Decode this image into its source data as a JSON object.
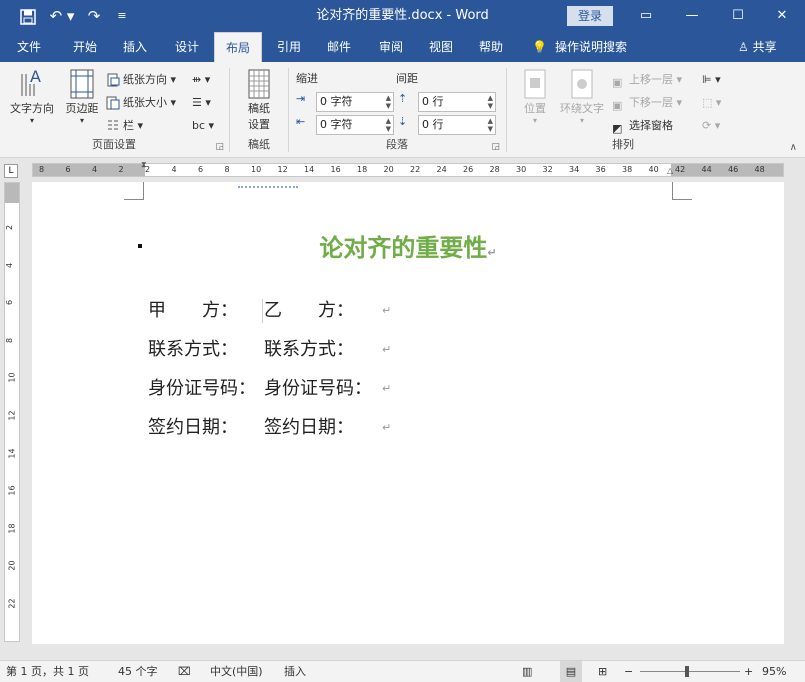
{
  "window": {
    "title": "论对齐的重要性.docx - Word",
    "login_label": "登录",
    "quick_access": [
      "save-icon",
      "undo-icon",
      "redo-icon",
      "customize-icon"
    ]
  },
  "tabs": [
    {
      "label": "文件",
      "active": false
    },
    {
      "label": "开始",
      "active": false
    },
    {
      "label": "插入",
      "active": false
    },
    {
      "label": "设计",
      "active": false
    },
    {
      "label": "布局",
      "active": true
    },
    {
      "label": "引用",
      "active": false
    },
    {
      "label": "邮件",
      "active": false
    },
    {
      "label": "审阅",
      "active": false
    },
    {
      "label": "视图",
      "active": false
    },
    {
      "label": "帮助",
      "active": false
    }
  ],
  "tell_me": "操作说明搜索",
  "share": "共享",
  "ribbon": {
    "page_setup": {
      "label": "页面设置",
      "text_direction": "文字方向",
      "margins": "页边距",
      "orientation": "纸张方向",
      "size": "纸张大小",
      "columns": "栏"
    },
    "manuscript": {
      "label": "稿纸",
      "button_line1": "稿纸",
      "button_line2": "设置"
    },
    "paragraph": {
      "label": "段落",
      "indent_label": "缩进",
      "spacing_label": "间距",
      "indent_left": "0 字符",
      "indent_right": "0 字符",
      "spacing_before": "0 行",
      "spacing_after": "0 行"
    },
    "arrange": {
      "label": "排列",
      "position": "位置",
      "wrap_text": "环绕文字",
      "bring_forward": "上移一层",
      "send_backward": "下移一层",
      "selection_pane": "选择窗格"
    }
  },
  "ruler": {
    "h_ticks": [
      "8",
      "6",
      "4",
      "2",
      "2",
      "4",
      "6",
      "8",
      "10",
      "12",
      "14",
      "16",
      "18",
      "20",
      "22",
      "24",
      "26",
      "28",
      "30",
      "32",
      "34",
      "36",
      "38",
      "40",
      "42",
      "44",
      "46",
      "48"
    ],
    "v_ticks": [
      "2",
      "4",
      "6",
      "8",
      "10",
      "12",
      "14",
      "16",
      "18",
      "20",
      "22"
    ]
  },
  "document": {
    "title": "论对齐的重要性",
    "rows": [
      {
        "left": "甲　　方：",
        "right": "乙　　方："
      },
      {
        "left": "联系方式：",
        "right": "联系方式："
      },
      {
        "left": "身份证号码：",
        "right": "身份证号码："
      },
      {
        "left": "签约日期：",
        "right": "签约日期："
      }
    ],
    "paragraph_mark": "↵"
  },
  "status": {
    "page": "第 1 页，共 1 页",
    "words": "45 个字",
    "language": "中文(中国)",
    "mode": "插入",
    "zoom": "95%",
    "zoom_minus": "−",
    "zoom_plus": "+"
  }
}
